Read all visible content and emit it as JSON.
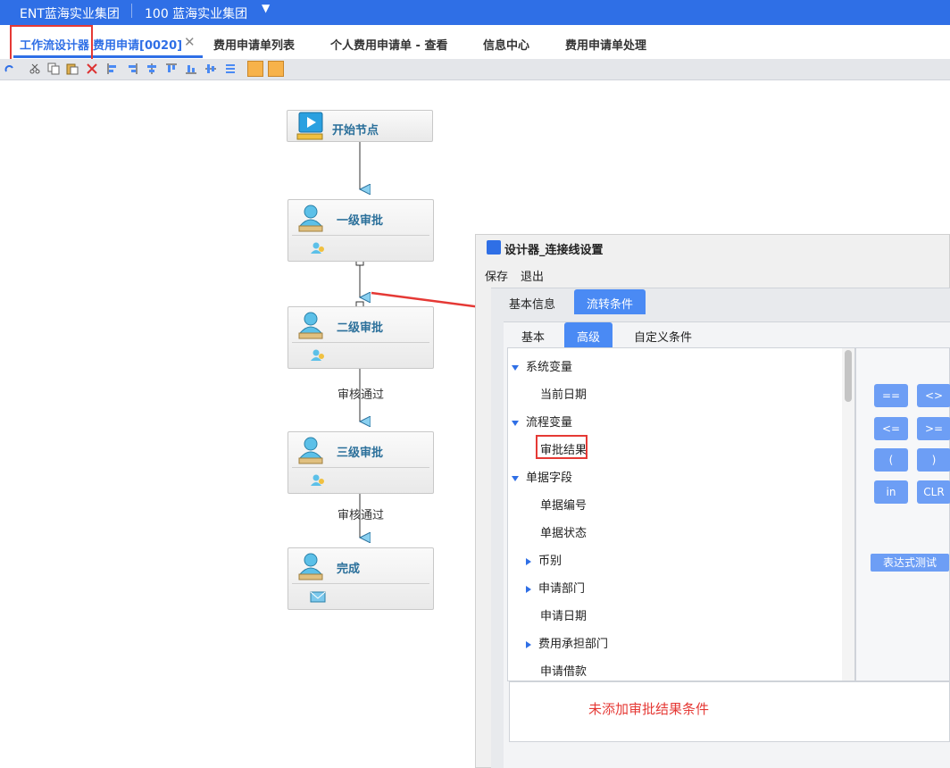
{
  "topbar": {
    "org_label": "ENT蓝海实业集团",
    "org_code": "100 蓝海实业集团",
    "caret": "▼"
  },
  "tabs": [
    {
      "label": "工作流设计器"
    },
    {
      "label": "费用申请[0020]"
    },
    {
      "label": "费用申请单列表"
    },
    {
      "label": "个人费用申请单 - 查看"
    },
    {
      "label": "信息中心"
    },
    {
      "label": "费用申请单处理"
    }
  ],
  "tab_close": "✕",
  "nodes": [
    {
      "title": "开始节点"
    },
    {
      "title": "一级审批"
    },
    {
      "title": "二级审批"
    },
    {
      "title": "三级审批"
    },
    {
      "title": "完成"
    }
  ],
  "flow_labels": [
    "审核通过",
    "审核通过"
  ],
  "dialog": {
    "title": "设计器_连接线设置",
    "menu": [
      "保存",
      "退出"
    ],
    "tabs": [
      "基本信息",
      "流转条件"
    ],
    "subtabs": [
      "基本",
      "高级",
      "自定义条件"
    ],
    "tree": [
      {
        "label": "系统变量",
        "kind": "group"
      },
      {
        "label": "当前日期",
        "kind": "leaf"
      },
      {
        "label": "流程变量",
        "kind": "group"
      },
      {
        "label": "审批结果",
        "kind": "leaf"
      },
      {
        "label": "单据字段",
        "kind": "group"
      },
      {
        "label": "单据编号",
        "kind": "leaf"
      },
      {
        "label": "单据状态",
        "kind": "leaf"
      },
      {
        "label": "币别",
        "kind": "collapsed"
      },
      {
        "label": "申请部门",
        "kind": "collapsed"
      },
      {
        "label": "申请日期",
        "kind": "leaf"
      },
      {
        "label": "费用承担部门",
        "kind": "collapsed"
      },
      {
        "label": "申请借款",
        "kind": "leaf"
      }
    ],
    "operators": [
      "==",
      "<>",
      "<=",
      ">=",
      "(",
      ")",
      "in",
      "CLR"
    ],
    "test_button": "表达式测试",
    "note": "未添加审批结果条件"
  },
  "colors": {
    "accent": "#2f6fe6",
    "annotation": "#e53935",
    "button": "#6d9ef5"
  }
}
